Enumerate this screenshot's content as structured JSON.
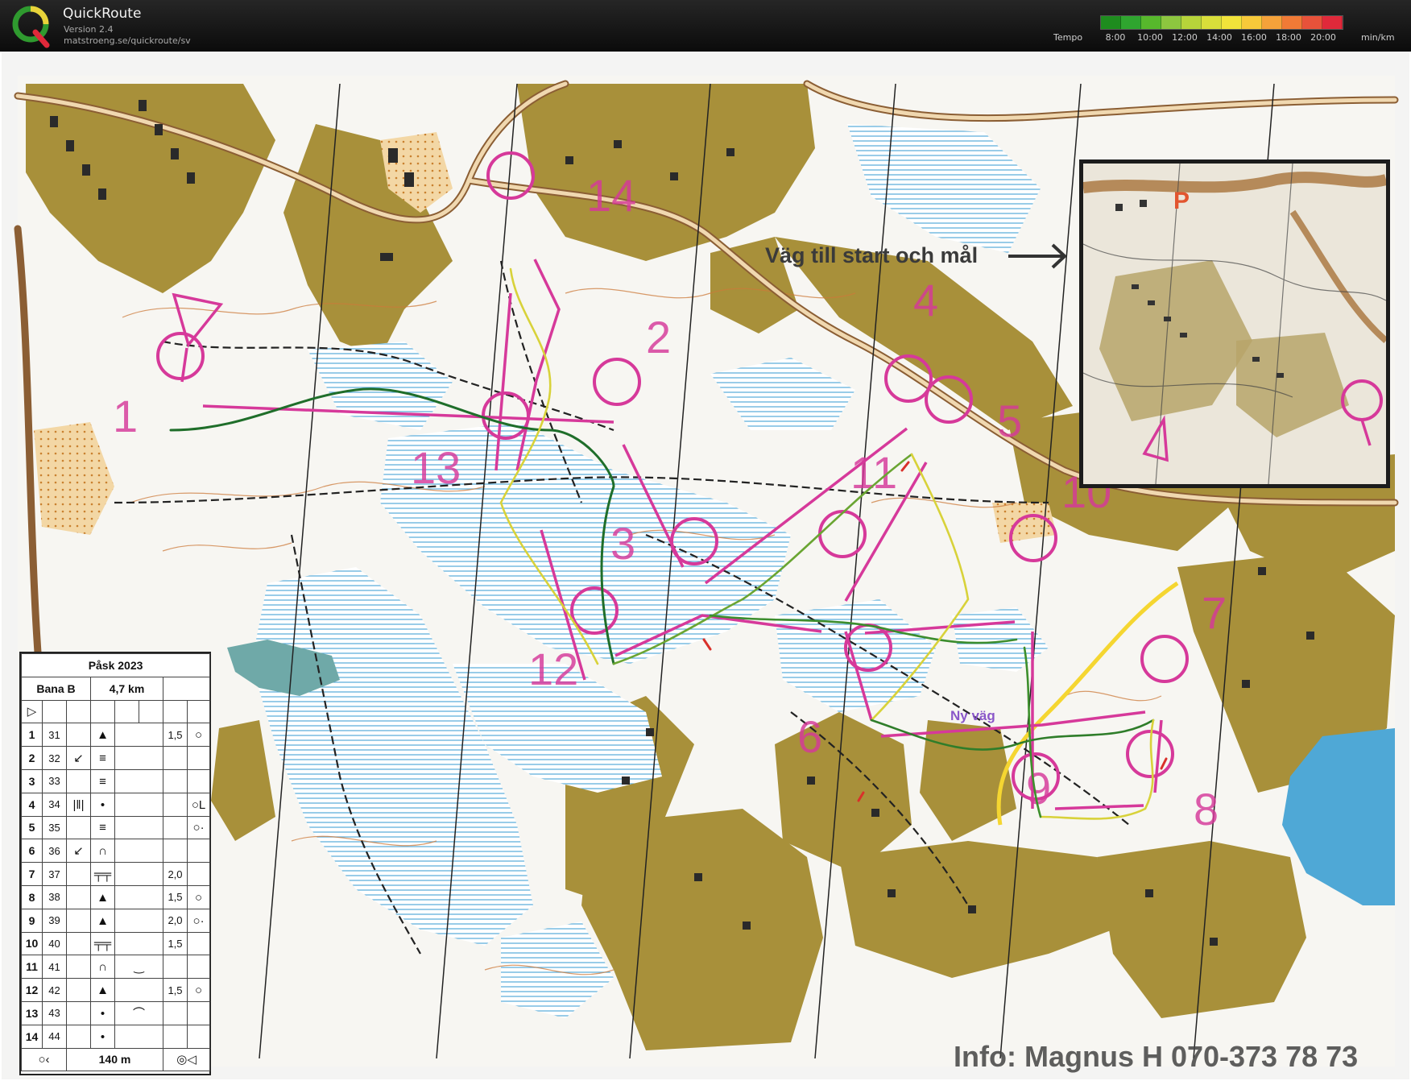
{
  "app": {
    "title": "QuickRoute",
    "version": "Version 2.4",
    "url": "matstroeng.se/quickroute/sv"
  },
  "tempo_legend": {
    "label": "Tempo",
    "unit": "min/km",
    "ticks": [
      "8:00",
      "10:00",
      "12:00",
      "14:00",
      "16:00",
      "18:00",
      "20:00"
    ],
    "colors": [
      "#1e8c1e",
      "#2fa52f",
      "#57b82c",
      "#8dc63f",
      "#b7d43a",
      "#d9de3a",
      "#f1e33a",
      "#f7c93a",
      "#f5a23a",
      "#f07a36",
      "#e8523a",
      "#e0293a"
    ]
  },
  "map": {
    "texts": {
      "road_label": "Väg till start och mål",
      "info": "Info: Magnus H 070-373 78 73",
      "road_label_2": "Ny väg",
      "parking": "P"
    },
    "course_color": "#d6399a",
    "controls": [
      {
        "n": "1"
      },
      {
        "n": "2"
      },
      {
        "n": "3"
      },
      {
        "n": "4"
      },
      {
        "n": "5"
      },
      {
        "n": "6"
      },
      {
        "n": "7"
      },
      {
        "n": "8"
      },
      {
        "n": "9"
      },
      {
        "n": "10"
      },
      {
        "n": "11"
      },
      {
        "n": "12"
      },
      {
        "n": "13"
      },
      {
        "n": "14"
      }
    ]
  },
  "description_sheet": {
    "event": "Påsk 2023",
    "course": "Bana B",
    "length": "4,7 km",
    "rows": [
      {
        "n": "1",
        "code": "31",
        "c": "",
        "d": "▲",
        "e": "",
        "f": "1,5",
        "g": "○"
      },
      {
        "n": "2",
        "code": "32",
        "c": "↙",
        "d": "≡",
        "e": "",
        "f": "",
        "g": ""
      },
      {
        "n": "3",
        "code": "33",
        "c": "",
        "d": "≡",
        "e": "",
        "f": "",
        "g": ""
      },
      {
        "n": "4",
        "code": "34",
        "c": "|‖|",
        "d": "•",
        "e": "",
        "f": "",
        "g": "○L"
      },
      {
        "n": "5",
        "code": "35",
        "c": "",
        "d": "≡",
        "e": "",
        "f": "",
        "g": "○·"
      },
      {
        "n": "6",
        "code": "36",
        "c": "↙",
        "d": "∩",
        "e": "",
        "f": "",
        "g": ""
      },
      {
        "n": "7",
        "code": "37",
        "c": "",
        "d": "╤╤",
        "e": "",
        "f": "2,0",
        "g": ""
      },
      {
        "n": "8",
        "code": "38",
        "c": "",
        "d": "▲",
        "e": "",
        "f": "1,5",
        "g": "○"
      },
      {
        "n": "9",
        "code": "39",
        "c": "",
        "d": "▲",
        "e": "",
        "f": "2,0",
        "g": "○·"
      },
      {
        "n": "10",
        "code": "40",
        "c": "",
        "d": "╤╤",
        "e": "",
        "f": "1,5",
        "g": ""
      },
      {
        "n": "11",
        "code": "41",
        "c": "",
        "d": "∩",
        "e": "‿",
        "f": "",
        "g": ""
      },
      {
        "n": "12",
        "code": "42",
        "c": "",
        "d": "▲",
        "e": "",
        "f": "1,5",
        "g": "○"
      },
      {
        "n": "13",
        "code": "43",
        "c": "",
        "d": "•",
        "e": "⌒",
        "f": "",
        "g": ""
      },
      {
        "n": "14",
        "code": "44",
        "c": "",
        "d": "•",
        "e": "",
        "f": "",
        "g": ""
      }
    ],
    "finish_distance": "140 m"
  }
}
